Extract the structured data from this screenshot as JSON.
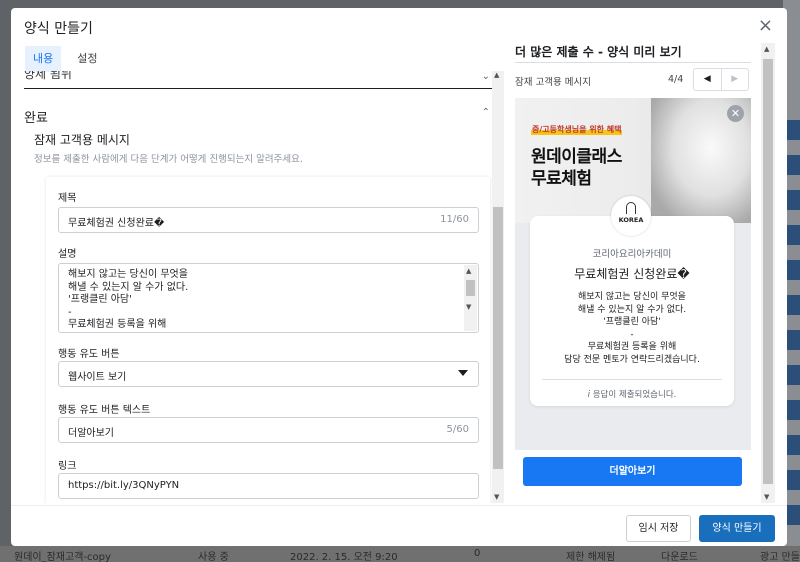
{
  "modal": {
    "title": "양식 만들기",
    "close_glyph": "×"
  },
  "tabs": [
    {
      "label": "내용",
      "active": true
    },
    {
      "label": "설정",
      "active": false
    }
  ],
  "content": {
    "cut_section_label": "양제 됨뉘",
    "section_title": "완료",
    "subsection_title": "잠재 고객용 메시지",
    "subsection_desc": "정보를 제출한 사람에게 다음 단계가 어떻게 진행되는지 알려주세요.",
    "fields": {
      "title": {
        "label": "제목",
        "value": "무료체험권 신청완료�",
        "counter": "11/60"
      },
      "description": {
        "label": "설명",
        "lines": [
          "해보지 않고는 당신이 무엇을",
          "해낼 수 있는지 알 수가 없다.",
          "'프랭클린 아담'",
          "-",
          "무료체험권 등록을 위해"
        ]
      },
      "cta_type": {
        "label": "행동 유도 버튼",
        "value": "웹사이트 보기"
      },
      "cta_text": {
        "label": "행동 유도 버튼 텍스트",
        "value": "더알아보기",
        "counter": "5/60"
      },
      "link": {
        "label": "링크",
        "value": "https://bit.ly/3QNyPYN"
      }
    }
  },
  "preview": {
    "title": "더 많은 제출 수 - 양식 미리 보기",
    "subtitle": "잠재 고객용 메시지",
    "page": "4/4",
    "hero_tag": "중/고등학생님을 위한 혜택",
    "hero_line1": "원데이클래스",
    "hero_line2": "무료체험",
    "logo_text": "KOREA",
    "org": "코리아요리아카데미",
    "card_title": "무료체험권 신청완료�",
    "card_body": [
      "해보지 않고는 당신이 무엇을",
      "해낼 수 있는지 알 수가 없다.",
      "'프랭클린 아담'",
      "-",
      "무료체험권 등록을 위해",
      "담당 전문 멘토가 연락드리겠습니다."
    ],
    "note": "응답이 제출되었습니다.",
    "cta": "더알아보기"
  },
  "footer": {
    "save_label": "임시 저장",
    "create_label": "양식 만들기"
  },
  "background": {
    "row_name": "원데이_잠재고객-copy",
    "status": "사용 중",
    "date": "2022. 2. 15. 오전 9:20",
    "count": "0",
    "restrict": "제한 해제됨",
    "download": "다운로드",
    "right_label": "광고 만들"
  },
  "colors": {
    "accent": "#1877f2",
    "primary_button": "#1a6fbd",
    "overlay": "#5f6368"
  }
}
